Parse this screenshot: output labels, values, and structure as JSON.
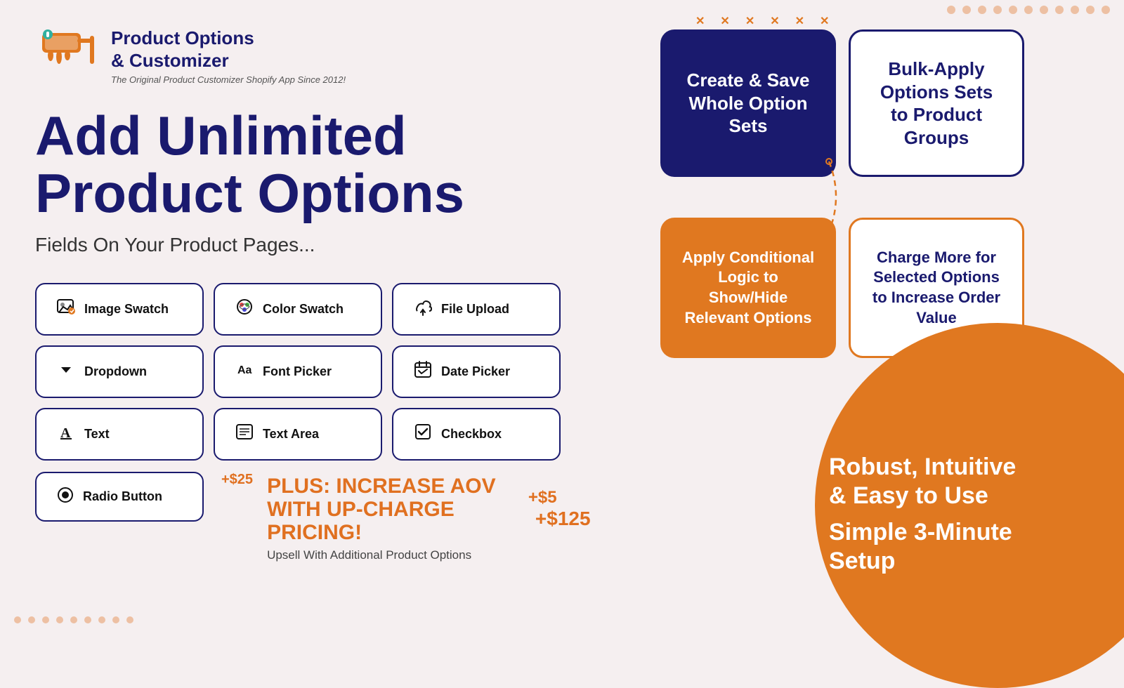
{
  "logo": {
    "title_line1": "Product Options",
    "title_line2": "& Customizer",
    "subtitle": "The Original Product Customizer Shopify App Since 2012!"
  },
  "headline": {
    "line1": "Add Unlimited",
    "line2": "Product Options"
  },
  "subheadline": "Fields On Your  Product Pages...",
  "option_buttons": [
    {
      "icon": "🖼",
      "label": "Image Swatch"
    },
    {
      "icon": "🎨",
      "label": "Color Swatch"
    },
    {
      "icon": "🔗",
      "label": "File Upload"
    },
    {
      "icon": "▼",
      "label": "Dropdown"
    },
    {
      "icon": "Aa",
      "label": "Font Picker"
    },
    {
      "icon": "📅",
      "label": "Date Picker"
    },
    {
      "icon": "A",
      "label": "Text"
    },
    {
      "icon": "📄",
      "label": "Text Area"
    },
    {
      "icon": "☑",
      "label": "Checkbox"
    }
  ],
  "radio_button": {
    "icon": "⊙",
    "label": "Radio Button"
  },
  "aov": {
    "title_line1": "PLUS: INCREASE AOV",
    "title_line2": "WITH UP-CHARGE PRICING!",
    "subtitle": "Upsell With Additional Product Options",
    "price1": "+$5",
    "price2": "+$125",
    "price3": "+$25"
  },
  "feature_cards": [
    {
      "id": "create-save",
      "style": "dark",
      "text": "Create & Save Whole Option Sets"
    },
    {
      "id": "bulk-apply",
      "style": "dark-outline",
      "text": "Bulk-Apply Options Sets to Product Groups"
    },
    {
      "id": "conditional",
      "style": "orange",
      "text": "Apply Conditional Logic to Show/Hide Relevant Options"
    },
    {
      "id": "charge-more",
      "style": "orange-outline",
      "text": "Charge More for Selected Options to Increase Order Value"
    }
  ],
  "bottom_right": {
    "line1": "Robust, Intuitive",
    "line2": "& Easy to Use",
    "line3": "Simple 3-Minute",
    "line4": "Setup"
  }
}
